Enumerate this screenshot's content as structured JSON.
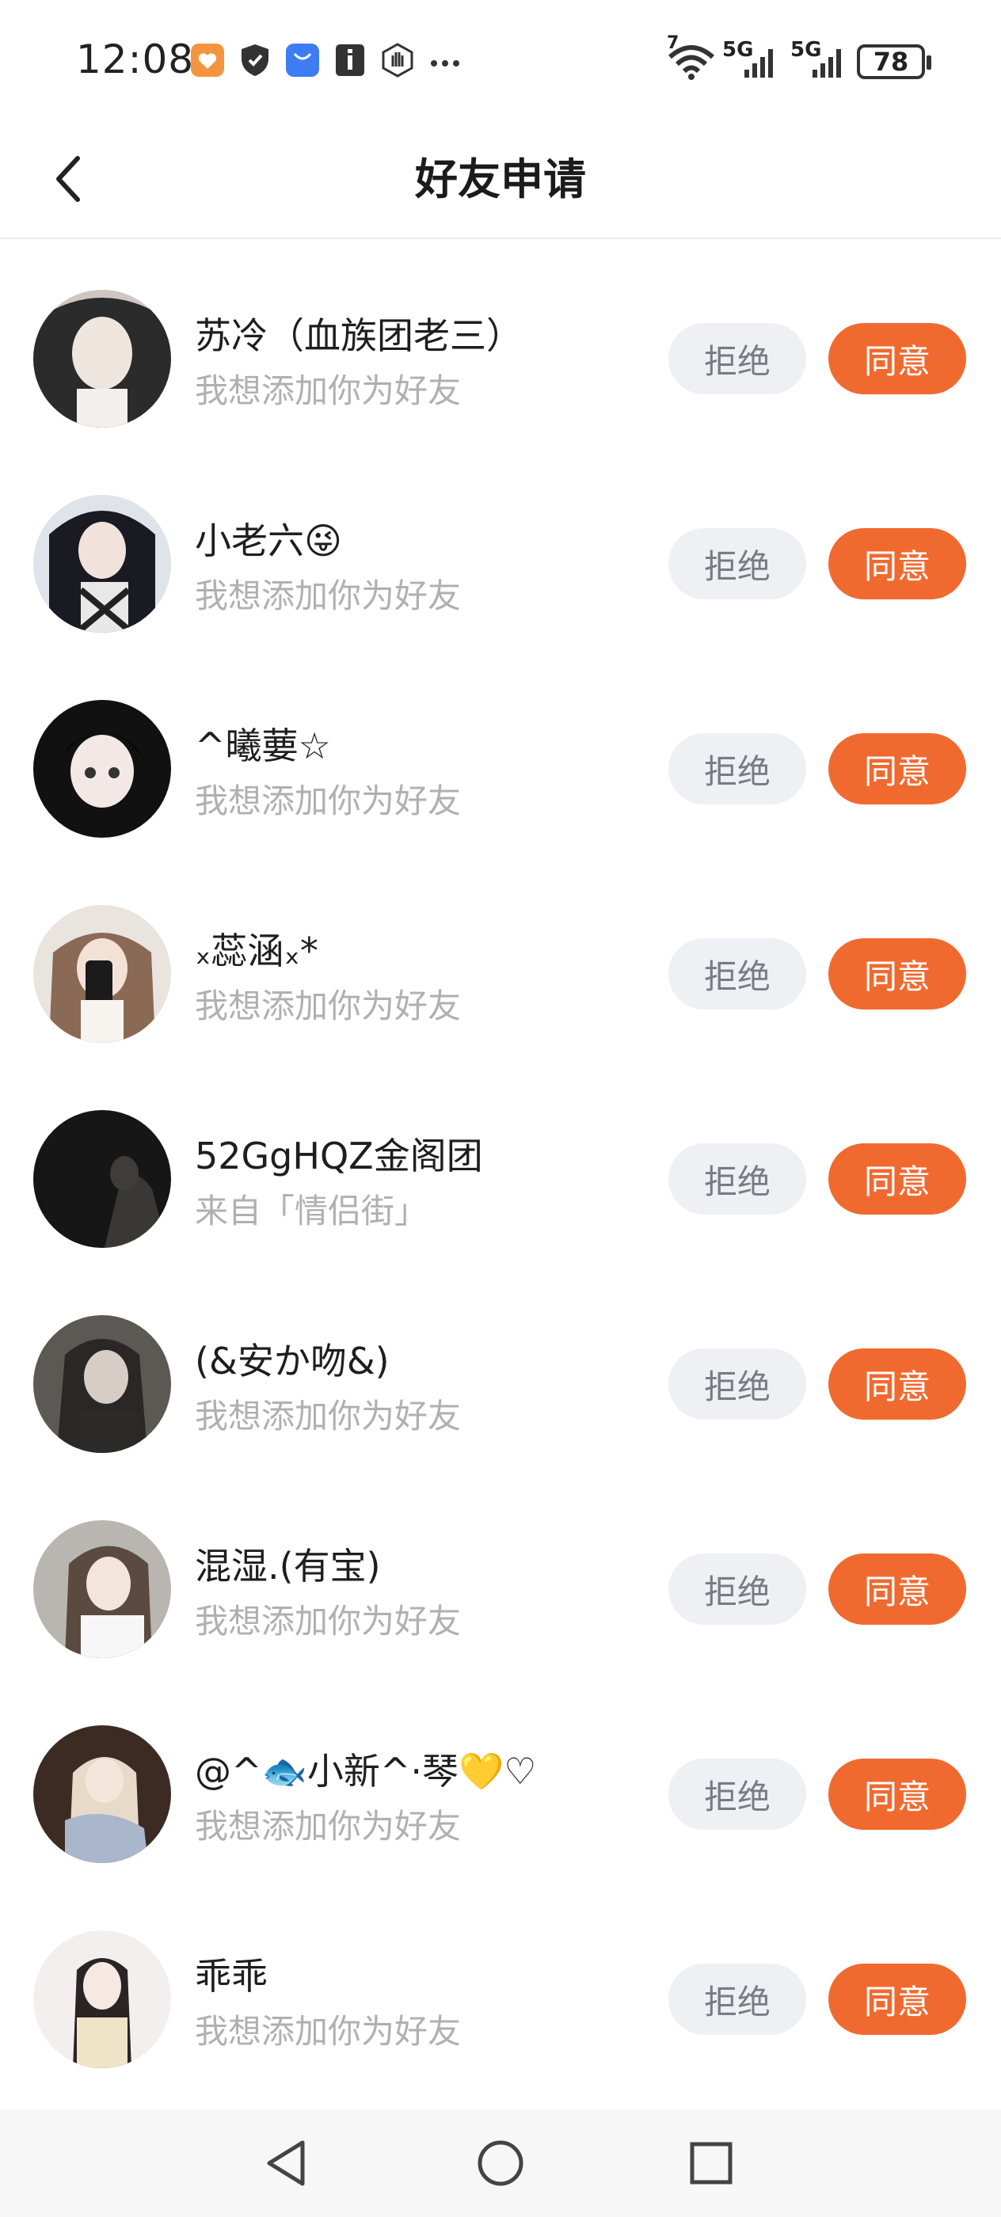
{
  "status_bar": {
    "time": "12:08",
    "network_1": "5G",
    "network_2": "5G",
    "wifi_sup": "7",
    "battery": "78",
    "icons": [
      "app-orange-heart-icon",
      "shield-icon",
      "store-bag-icon",
      "info-icon",
      "hand-icon",
      "more-dots-icon",
      "wifi-icon",
      "signal-icon",
      "battery-icon"
    ]
  },
  "header": {
    "title": "好友申请",
    "back_icon": "chevron-left-icon"
  },
  "requests": [
    {
      "name": "苏冷（血族团老三）",
      "message": "我想添加你为好友",
      "avatar_color": "#8a8a8a"
    },
    {
      "name": "小老六😜",
      "message": "我想添加你为好友",
      "avatar_color": "#3a3f55"
    },
    {
      "name": "^曦葽☆",
      "message": "我想添加你为好友",
      "avatar_color": "#2a2a2a"
    },
    {
      "name": "ₓ蕊涵ₓ*",
      "message": "我想添加你为好友",
      "avatar_color": "#c9b7a8"
    },
    {
      "name": "52GgHQZ金阁团",
      "message": "来自「情侣街」",
      "avatar_color": "#1c1c1c"
    },
    {
      "name": "(&安か吻&)",
      "message": "我想添加你为好友",
      "avatar_color": "#4a4744"
    },
    {
      "name": "混湿.(有宝)",
      "message": "我想添加你为好友",
      "avatar_color": "#9a9590"
    },
    {
      "name": "@^🐟小新^·琴💛♡",
      "message": "我想添加你为好友",
      "avatar_color": "#4b3a30"
    },
    {
      "name": "乖乖",
      "message": "我想添加你为好友",
      "avatar_color": "#e9dcdc"
    }
  ],
  "buttons": {
    "reject": "拒绝",
    "accept": "同意"
  },
  "colors": {
    "accent": "#f06a30",
    "reject_bg": "#eff0f4",
    "subtext": "#b0b0b0"
  },
  "nav_bar": {
    "icons": [
      "back-triangle-icon",
      "home-circle-icon",
      "recents-square-icon"
    ]
  }
}
